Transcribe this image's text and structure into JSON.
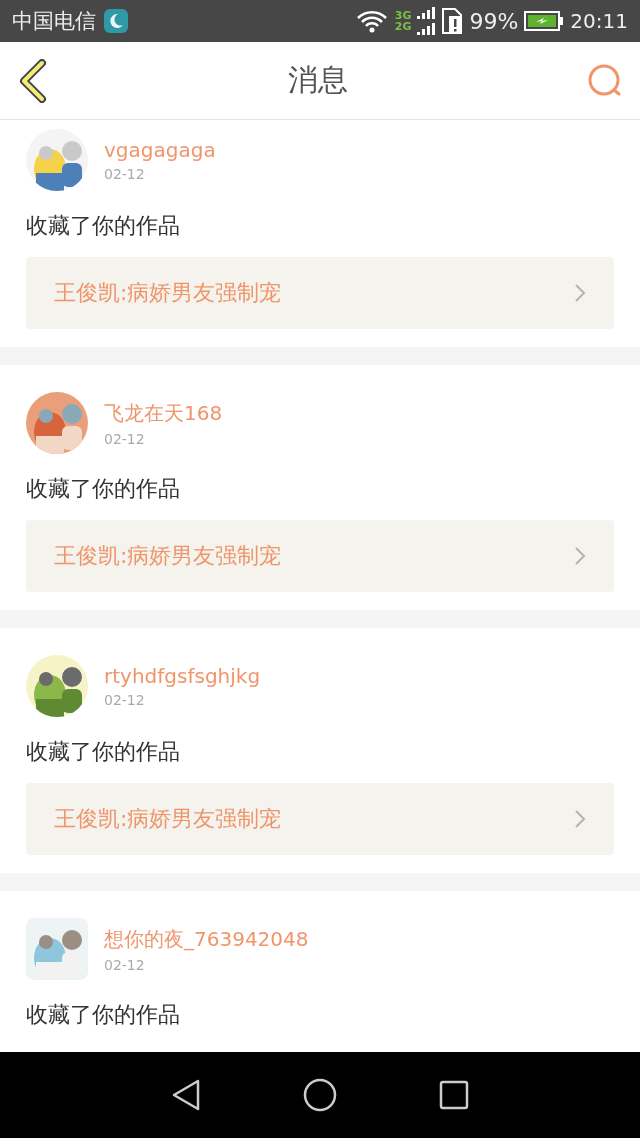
{
  "status_bar": {
    "carrier": "中国电信",
    "network_labels": [
      "3G",
      "2G"
    ],
    "battery": "99%",
    "time": "20:11"
  },
  "header": {
    "title": "消息"
  },
  "messages": [
    {
      "user": "vgagagaga",
      "date": "02-12",
      "action": "收藏了你的作品",
      "link": "王俊凯:病娇男友强制宠"
    },
    {
      "user": "飞龙在天168",
      "date": "02-12",
      "action": "收藏了你的作品",
      "link": "王俊凯:病娇男友强制宠"
    },
    {
      "user": "rtyhdfgsfsghjkg",
      "date": "02-12",
      "action": "收藏了你的作品",
      "link": "王俊凯:病娇男友强制宠"
    },
    {
      "user": "想你的夜_763942048",
      "date": "02-12",
      "action": "收藏了你的作品"
    }
  ]
}
